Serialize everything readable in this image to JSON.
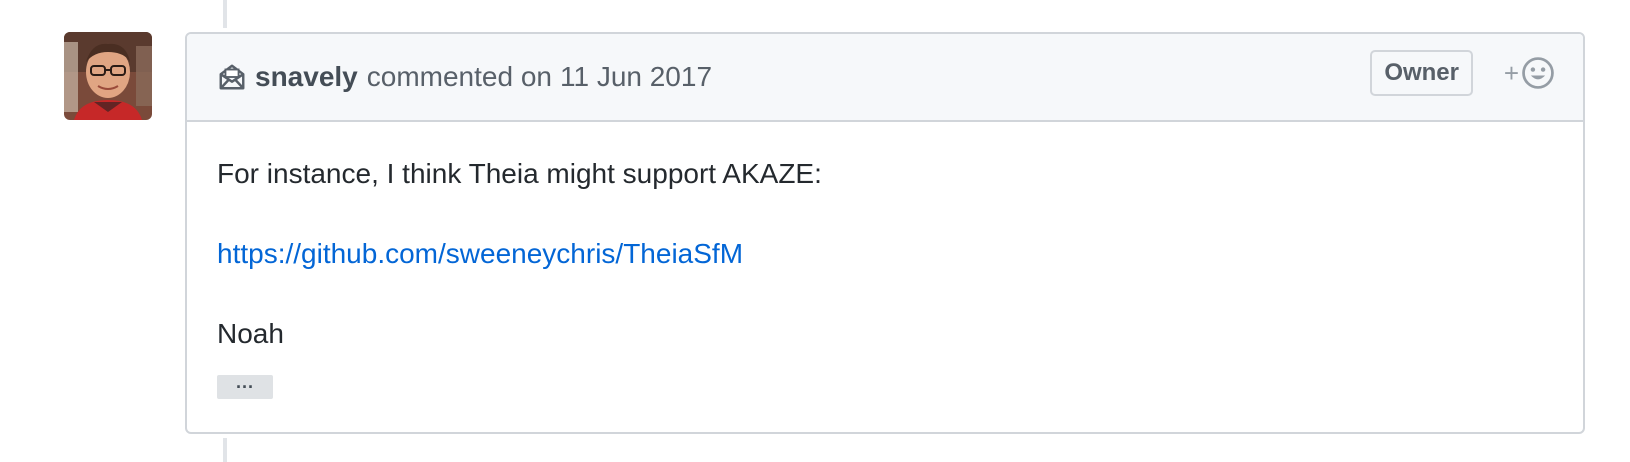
{
  "comment": {
    "author": "snavely",
    "action": "commented on",
    "date": "11 Jun 2017",
    "badge": "Owner",
    "reaction_plus": "+",
    "body": {
      "line1": "For instance, I think Theia might support AKAZE:",
      "link": "https://github.com/sweeneychris/TheiaSfM",
      "signature": "Noah",
      "ellipsis": "···"
    }
  },
  "icons": {
    "header_icon": "mail-icon",
    "reaction_icon": "smiley-icon"
  },
  "colors": {
    "header_bg": "#f6f8fa",
    "border": "#d1d5da",
    "link": "#0366d6",
    "muted_text": "#586069"
  }
}
